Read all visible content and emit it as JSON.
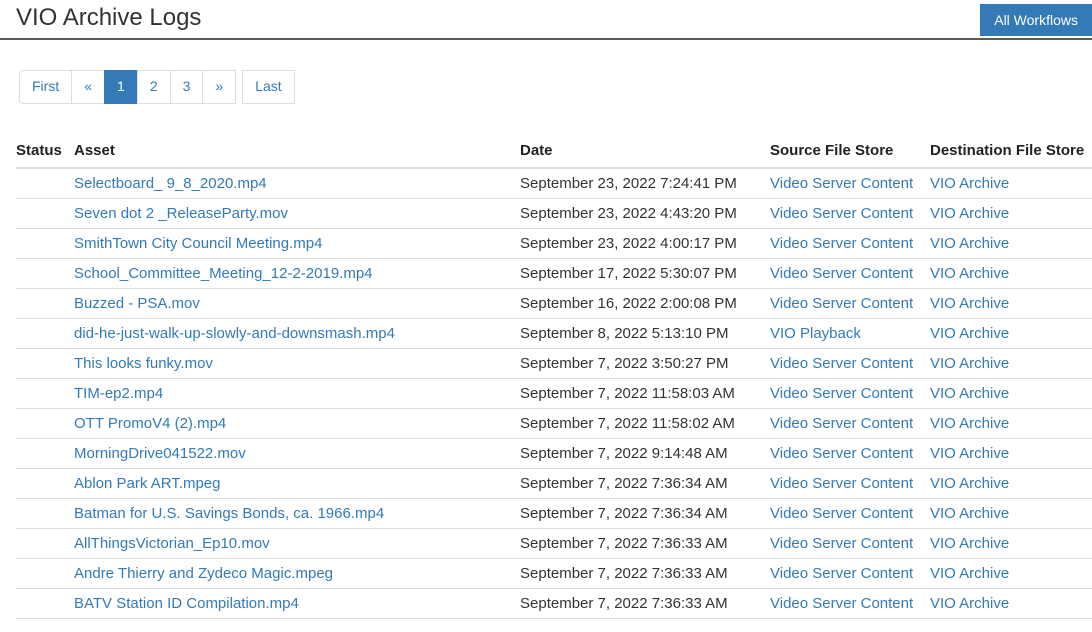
{
  "header": {
    "title": "VIO Archive Logs",
    "all_workflows_btn": "All Workflows"
  },
  "pagination": {
    "first": "First",
    "prev": "«",
    "pages": [
      "1",
      "2",
      "3"
    ],
    "active_page": "1",
    "next": "»",
    "last": "Last"
  },
  "table": {
    "columns": {
      "status": "Status",
      "asset": "Asset",
      "date": "Date",
      "source": "Source File Store",
      "destination": "Destination File Store"
    },
    "rows": [
      {
        "asset": "Selectboard_ 9_8_2020.mp4",
        "date": "September 23, 2022 7:24:41 PM",
        "source": "Video Server Content",
        "destination": "VIO Archive"
      },
      {
        "asset": "Seven dot 2 _ReleaseParty.mov",
        "date": "September 23, 2022 4:43:20 PM",
        "source": "Video Server Content",
        "destination": "VIO Archive"
      },
      {
        "asset": "SmithTown City Council Meeting.mp4",
        "date": "September 23, 2022 4:00:17 PM",
        "source": "Video Server Content",
        "destination": "VIO Archive"
      },
      {
        "asset": "School_Committee_Meeting_12-2-2019.mp4",
        "date": "September 17, 2022 5:30:07 PM",
        "source": "Video Server Content",
        "destination": "VIO Archive"
      },
      {
        "asset": "Buzzed - PSA.mov",
        "date": "September 16, 2022 2:00:08 PM",
        "source": "Video Server Content",
        "destination": "VIO Archive"
      },
      {
        "asset": "did-he-just-walk-up-slowly-and-downsmash.mp4",
        "date": "September 8, 2022 5:13:10 PM",
        "source": "VIO Playback",
        "destination": "VIO Archive"
      },
      {
        "asset": "This looks funky.mov",
        "date": "September 7, 2022 3:50:27 PM",
        "source": "Video Server Content",
        "destination": "VIO Archive"
      },
      {
        "asset": "TIM-ep2.mp4",
        "date": "September 7, 2022 11:58:03 AM",
        "source": "Video Server Content",
        "destination": "VIO Archive"
      },
      {
        "asset": "OTT PromoV4 (2).mp4",
        "date": "September 7, 2022 11:58:02 AM",
        "source": "Video Server Content",
        "destination": "VIO Archive"
      },
      {
        "asset": "MorningDrive041522.mov",
        "date": "September 7, 2022 9:14:48 AM",
        "source": "Video Server Content",
        "destination": "VIO Archive"
      },
      {
        "asset": "Ablon Park ART.mpeg",
        "date": "September 7, 2022 7:36:34 AM",
        "source": "Video Server Content",
        "destination": "VIO Archive"
      },
      {
        "asset": "Batman for U.S. Savings Bonds, ca. 1966.mp4",
        "date": "September 7, 2022 7:36:34 AM",
        "source": "Video Server Content",
        "destination": "VIO Archive"
      },
      {
        "asset": "AllThingsVictorian_Ep10.mov",
        "date": "September 7, 2022 7:36:33 AM",
        "source": "Video Server Content",
        "destination": "VIO Archive"
      },
      {
        "asset": "Andre Thierry and Zydeco Magic.mpeg",
        "date": "September 7, 2022 7:36:33 AM",
        "source": "Video Server Content",
        "destination": "VIO Archive"
      },
      {
        "asset": "BATV Station ID Compilation.mp4",
        "date": "September 7, 2022 7:36:33 AM",
        "source": "Video Server Content",
        "destination": "VIO Archive"
      }
    ]
  }
}
